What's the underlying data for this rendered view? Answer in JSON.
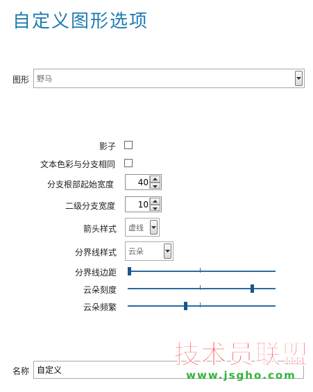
{
  "header": {
    "title": "自定义图形选项"
  },
  "shape": {
    "label": "图形",
    "value": "野马"
  },
  "options": {
    "shadow_label": "影子",
    "text_color_label": "文本色彩与分支相同",
    "branch_root_width_label": "分支根部起始宽度",
    "branch_root_width_value": "40",
    "second_level_width_label": "二级分支宽度",
    "second_level_width_value": "10",
    "arrow_style_label": "箭头样式",
    "arrow_style_value": "虚线",
    "boundary_style_label": "分界线样式",
    "boundary_style_value": "云朵",
    "boundary_margin_label": "分界线边距",
    "cloud_scale_label": "云朵刻度",
    "cloud_freq_label": "云朵频繁"
  },
  "sliders": {
    "boundary_margin": 0.0,
    "cloud_scale": 0.85,
    "cloud_freq": 0.39
  },
  "name_field": {
    "label": "名称",
    "value": "自定义"
  },
  "watermark": {
    "line1": "技术员联盟",
    "line2": "www.jsgho.com"
  },
  "colors": {
    "title": "#1f7bb0",
    "slider": "#2b6aa0"
  }
}
